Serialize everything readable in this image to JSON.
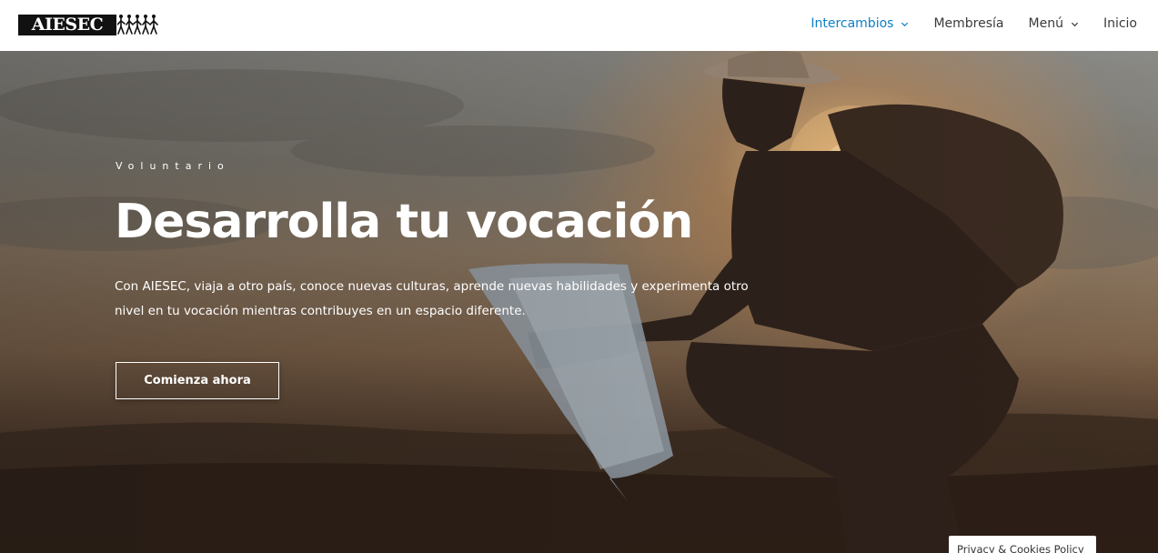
{
  "header": {
    "logo_text": "AIESEC",
    "nav": [
      {
        "label": "Intercambios",
        "has_dropdown": true,
        "active": true
      },
      {
        "label": "Membresía",
        "has_dropdown": false,
        "active": false
      },
      {
        "label": "Menú",
        "has_dropdown": true,
        "active": false
      },
      {
        "label": "Inicio",
        "has_dropdown": false,
        "active": false
      }
    ]
  },
  "hero": {
    "eyebrow": "Voluntario",
    "title": "Desarrolla tu vocación",
    "description": "Con AIESEC, viaja a otro país, conoce nuevas culturas, aprende nuevas habilidades y experimenta otro nivel en tu vocación mientras contribuyes en un espacio diferente.",
    "cta_label": "Comienza ahora",
    "background_image": "traveler-with-map-sunset"
  },
  "privacy_link": "Privacy & Cookies Policy",
  "colors": {
    "accent": "#0d7fc5",
    "nav_text": "#3a3a3a",
    "hero_text": "#ffffff"
  }
}
